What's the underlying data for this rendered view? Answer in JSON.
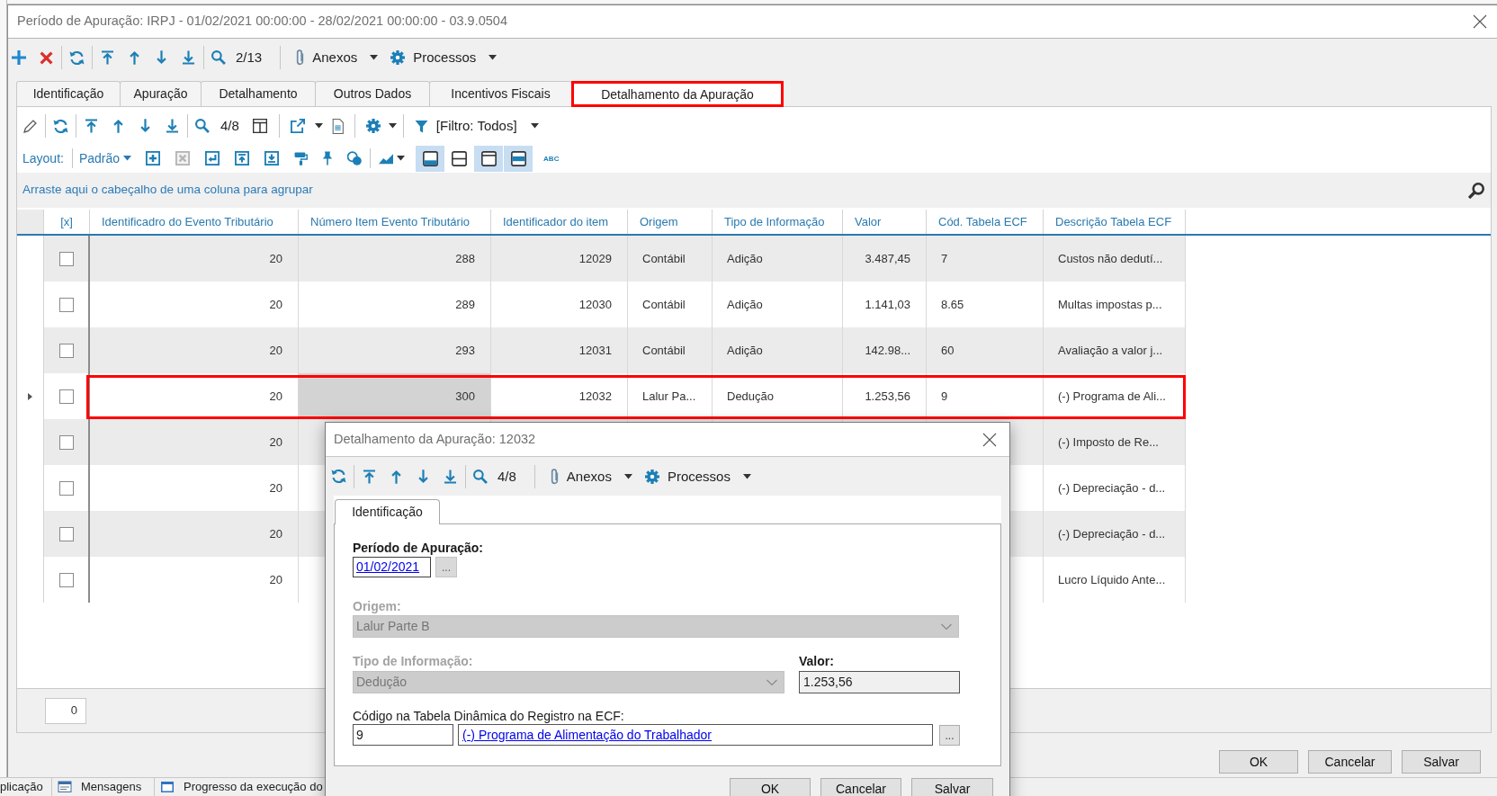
{
  "window": {
    "title": "Período de Apuração: IRPJ - 01/02/2021 00:00:00 - 28/02/2021 00:00:00 - 03.9.0504"
  },
  "toolbar": {
    "record_counter": "2/13",
    "attachments_menu": "Anexos",
    "processes_menu": "Processos"
  },
  "tabs": [
    {
      "label": "Identificação",
      "selected": false,
      "annotated": false
    },
    {
      "label": "Apuração",
      "selected": false,
      "annotated": false
    },
    {
      "label": "Detalhamento",
      "selected": false,
      "annotated": false
    },
    {
      "label": "Outros Dados",
      "selected": false,
      "annotated": false
    },
    {
      "label": "Incentivos Fiscais",
      "selected": false,
      "annotated": false
    },
    {
      "label": "Detalhamento da Apuração",
      "selected": true,
      "annotated": true
    }
  ],
  "grid_toolbar": {
    "record_counter": "4/8",
    "filter_menu": "[Filtro: Todos]"
  },
  "layout_bar": {
    "label": "Layout:",
    "layout_menu": "Padrão",
    "view_toggles": [
      {
        "kind": "bottom-bar",
        "selected": true
      },
      {
        "kind": "middle-line",
        "selected": false
      },
      {
        "kind": "top-line",
        "selected": true
      },
      {
        "kind": "middle-bar",
        "selected": true
      }
    ],
    "abc_button": "ABC"
  },
  "group_panel": {
    "hint": "Arraste aqui o cabeçalho de uma coluna para agrupar"
  },
  "table": {
    "columns": [
      {
        "label": "[x]",
        "kind": "checkbox",
        "focused": false
      },
      {
        "label": "Identificadro do Evento Tributário",
        "kind": "number",
        "focused": false
      },
      {
        "label": "Número Item Evento Tributário",
        "kind": "number",
        "focused": true
      },
      {
        "label": "Identificador do item",
        "kind": "number",
        "focused": false
      },
      {
        "label": "Origem",
        "kind": "text",
        "focused": false
      },
      {
        "label": "Tipo de Informação",
        "kind": "text",
        "focused": false
      },
      {
        "label": "Valor",
        "kind": "number",
        "focused": false
      },
      {
        "label": "Cód. Tabela ECF",
        "kind": "text",
        "focused": false
      },
      {
        "label": "Descrição Tabela ECF",
        "kind": "text",
        "focused": false
      }
    ],
    "rows": [
      {
        "checked": false,
        "focused": false,
        "annotated": false,
        "event_id": "20",
        "event_item_number": "288",
        "item_id": "12029",
        "origin": "Contábil",
        "info_type": "Adição",
        "amount": "3.487,45",
        "ecf_code": "7",
        "ecf_description": "Custos não dedutí..."
      },
      {
        "checked": false,
        "focused": false,
        "annotated": false,
        "event_id": "20",
        "event_item_number": "289",
        "item_id": "12030",
        "origin": "Contábil",
        "info_type": "Adição",
        "amount": "1.141,03",
        "ecf_code": "8.65",
        "ecf_description": "Multas impostas p..."
      },
      {
        "checked": false,
        "focused": false,
        "annotated": false,
        "event_id": "20",
        "event_item_number": "293",
        "item_id": "12031",
        "origin": "Contábil",
        "info_type": "Adição",
        "amount": "142.98...",
        "ecf_code": "60",
        "ecf_description": "Avaliação a valor j..."
      },
      {
        "checked": false,
        "focused": true,
        "annotated": true,
        "event_id": "20",
        "event_item_number": "300",
        "item_id": "12032",
        "origin": "Lalur Pa...",
        "info_type": "Dedução",
        "amount": "1.253,56",
        "ecf_code": "9",
        "ecf_description": "(-) Programa de Ali..."
      },
      {
        "checked": false,
        "focused": false,
        "annotated": false,
        "event_id": "20",
        "ecf_description": "(-) Imposto de Re..."
      },
      {
        "checked": false,
        "focused": false,
        "annotated": false,
        "event_id": "20",
        "ecf_description": "(-) Depreciação - d..."
      },
      {
        "checked": false,
        "focused": false,
        "annotated": false,
        "event_id": "20",
        "ecf_description": "(-) Depreciação - d..."
      },
      {
        "checked": false,
        "focused": false,
        "annotated": false,
        "event_id": "20",
        "ecf_description": "Lucro Líquido Ante..."
      }
    ]
  },
  "footer": {
    "count": "0"
  },
  "buttons": [
    "OK",
    "Cancelar",
    "Salvar"
  ],
  "dialog": {
    "title": "Detalhamento da Apuração: 12032",
    "toolbar": {
      "record_counter": "4/8",
      "attachments_menu": "Anexos",
      "processes_menu": "Processos"
    },
    "tabs": [
      {
        "label": "Identificação",
        "selected": true
      }
    ],
    "period": {
      "label": "Período de Apuração:",
      "value": "01/02/2021",
      "browse_button": "..."
    },
    "origin": {
      "label": "Origem:",
      "value": "Lalur Parte B",
      "disabled": true
    },
    "info_type": {
      "label": "Tipo de Informação:",
      "value": "Dedução",
      "disabled": true
    },
    "amount": {
      "label": "Valor:",
      "value": "1.253,56",
      "read_only": true
    },
    "ecf_code": {
      "label": "Código na Tabela Dinâmica do Registro na ECF:",
      "code": "9",
      "description": "(-) Programa de Alimentação do Trabalhador",
      "browse_button": "..."
    },
    "buttons": [
      "OK",
      "Cancelar",
      "Salvar"
    ]
  },
  "status_bar": [
    {
      "kind": "text",
      "label": "plicação"
    },
    {
      "kind": "messages",
      "label": "Mensagens"
    },
    {
      "kind": "progress",
      "label": "Progresso da execução do"
    }
  ]
}
